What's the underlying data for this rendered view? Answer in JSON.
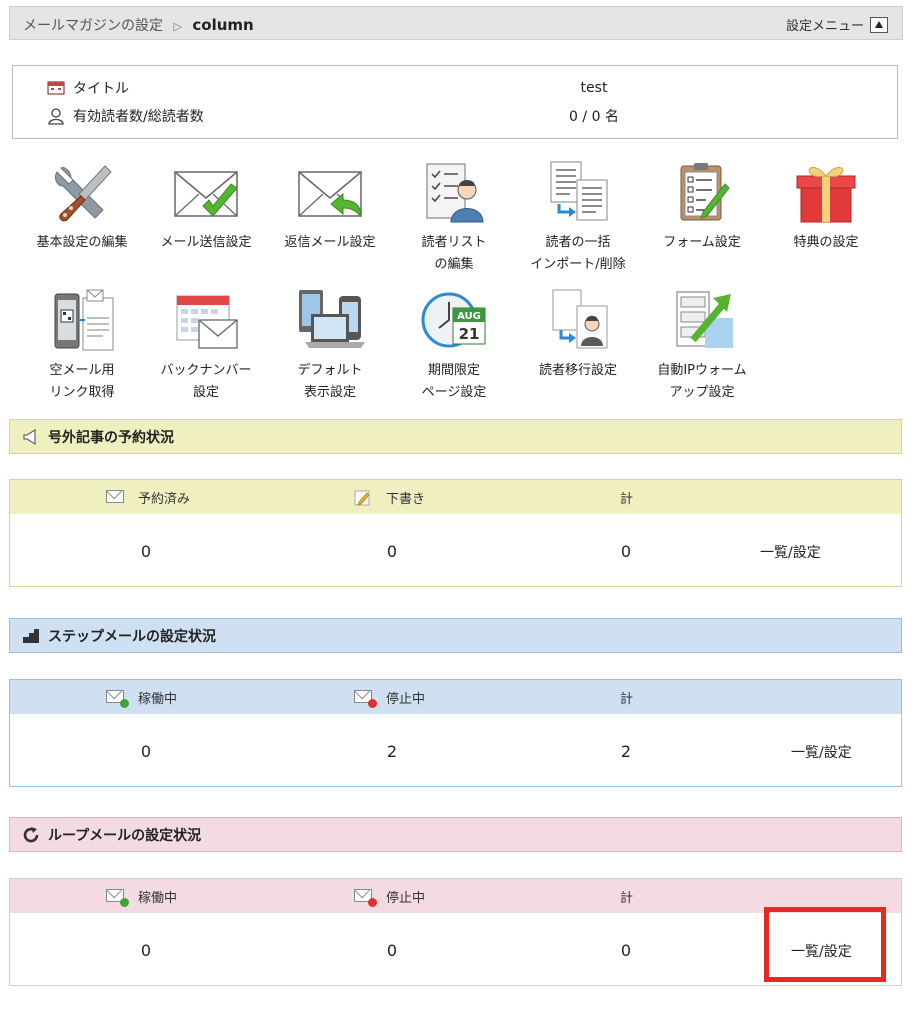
{
  "header": {
    "breadcrumb_parent": "メールマガジンの設定",
    "breadcrumb_sep": "▷",
    "breadcrumb_current": "column",
    "menu_label": "設定メニュー"
  },
  "info": {
    "title_label": "タイトル",
    "title_value": "test",
    "readers_label": "有効読者数/総読者数",
    "readers_value": "0 / 0 名"
  },
  "tiles": [
    {
      "label": "基本設定の編集",
      "icon": "tools-icon"
    },
    {
      "label": "メール送信設定",
      "icon": "mail-check-icon"
    },
    {
      "label": "返信メール設定",
      "icon": "mail-reply-icon"
    },
    {
      "label": "読者リスト\nの編集",
      "icon": "reader-list-icon"
    },
    {
      "label": "読者の一括\nインポート/削除",
      "icon": "import-icon"
    },
    {
      "label": "フォーム設定",
      "icon": "form-icon"
    },
    {
      "label": "特典の設定",
      "icon": "gift-icon"
    },
    {
      "label": "空メール用\nリンク取得",
      "icon": "phone-qr-icon"
    },
    {
      "label": "バックナンバー\n設定",
      "icon": "calendar-mail-icon"
    },
    {
      "label": "デフォルト\n表示設定",
      "icon": "devices-icon"
    },
    {
      "label": "期間限定\nページ設定",
      "icon": "clock-calendar-icon"
    },
    {
      "label": "読者移行設定",
      "icon": "reader-transfer-icon"
    },
    {
      "label": "自動IPウォーム\nアップ設定",
      "icon": "ip-warmup-icon"
    }
  ],
  "calendar_icon": {
    "month": "AUG",
    "day": "21"
  },
  "sections": {
    "extra": {
      "title": "号外記事の予約状況",
      "col1": "予約済み",
      "col2": "下書き",
      "col3": "計",
      "v1": "0",
      "v2": "0",
      "v3": "0",
      "link": "一覧/設定"
    },
    "step": {
      "title": "ステップメールの設定状況",
      "col1": "稼働中",
      "col2": "停止中",
      "col3": "計",
      "v1": "0",
      "v2": "2",
      "v3": "2",
      "link": "一覧/設定"
    },
    "loop": {
      "title": "ループメールの設定状況",
      "col1": "稼働中",
      "col2": "停止中",
      "col3": "計",
      "v1": "0",
      "v2": "0",
      "v3": "0",
      "link": "一覧/設定"
    }
  },
  "colors": {
    "yellow": "#f0efc0",
    "blue": "#cfe0f3",
    "pink": "#f4dbe2",
    "highlight": "#e62b1e",
    "green": "#55b431"
  }
}
